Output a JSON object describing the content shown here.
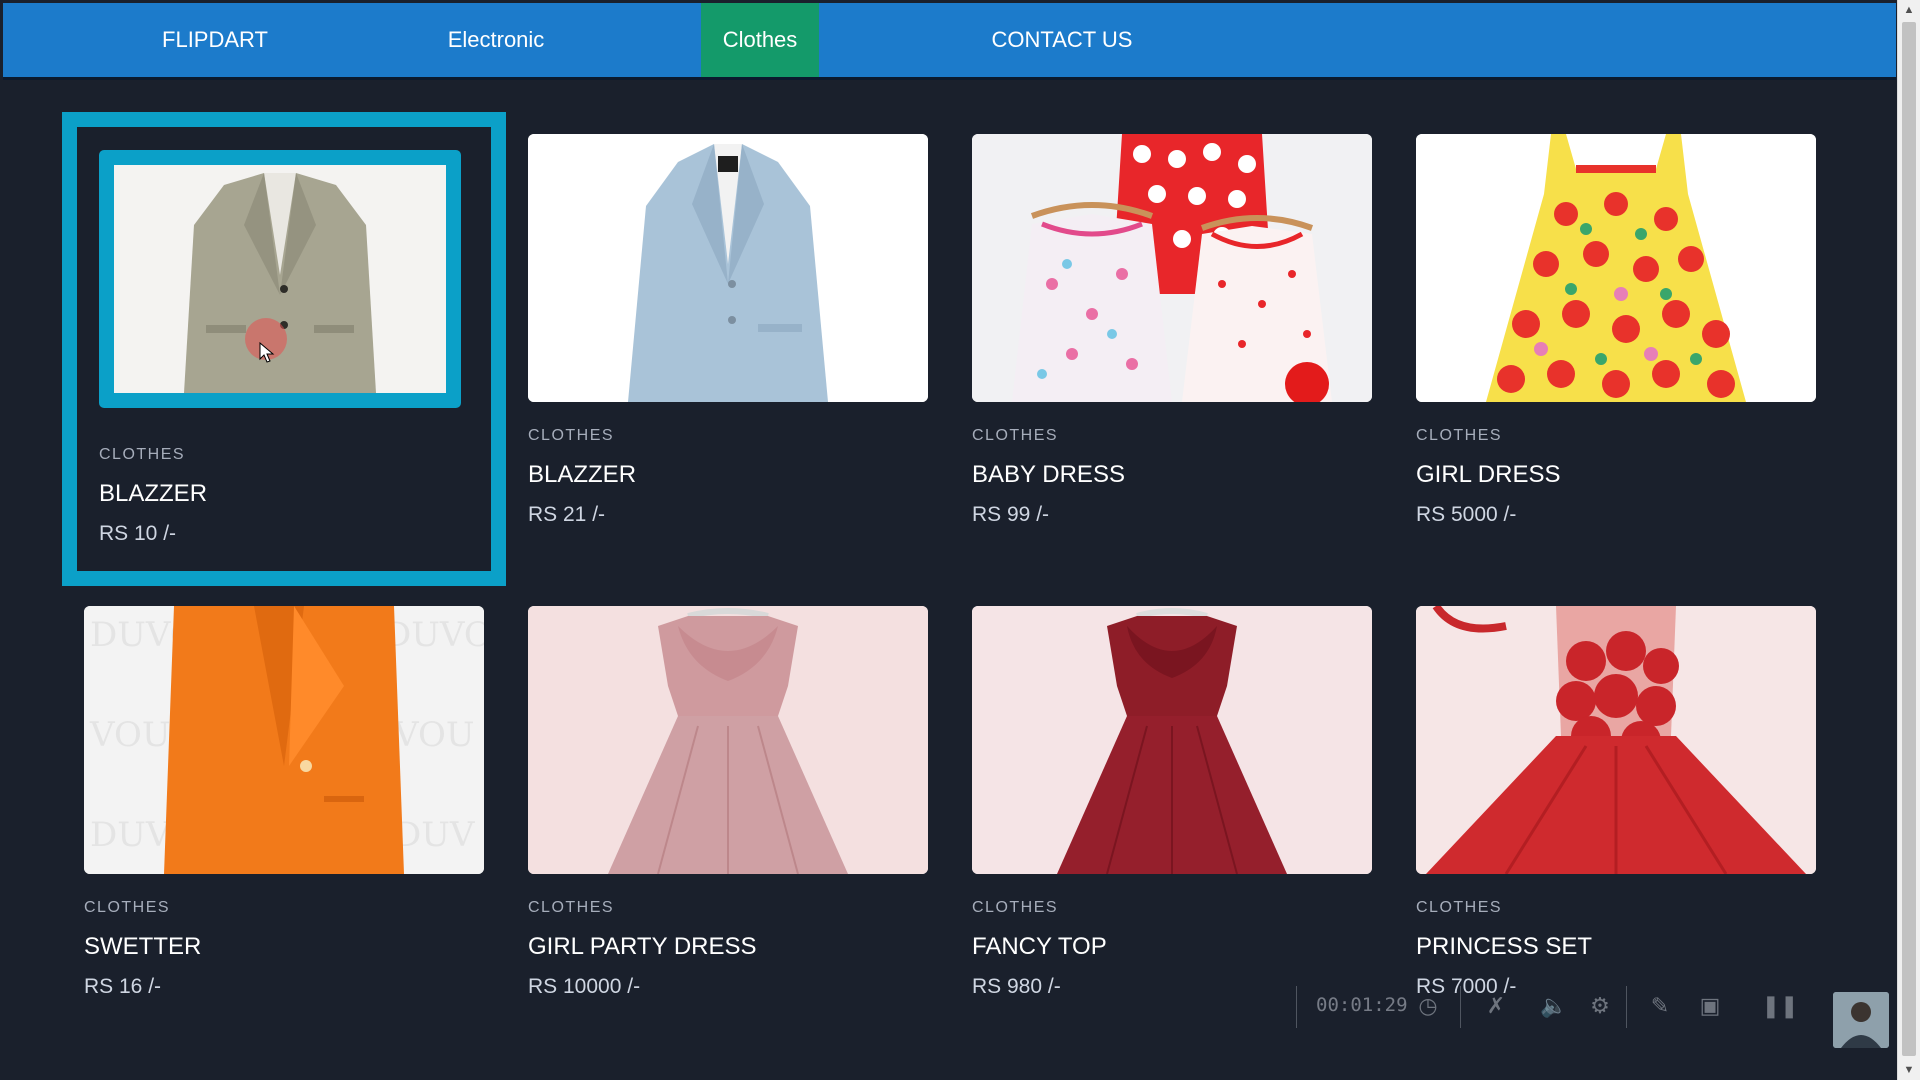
{
  "nav": {
    "brand": "FLIPDART",
    "items": [
      {
        "label": "Electronic"
      },
      {
        "label": "Clothes",
        "active": true
      },
      {
        "label": "CONTACT US"
      }
    ]
  },
  "products": [
    {
      "category": "CLOTHES",
      "title": "BLAZZER",
      "price": "RS 10 /-"
    },
    {
      "category": "CLOTHES",
      "title": "BLAZZER",
      "price": "RS 21 /-"
    },
    {
      "category": "CLOTHES",
      "title": "BABY DRESS",
      "price": "RS 99 /-"
    },
    {
      "category": "CLOTHES",
      "title": "GIRL DRESS",
      "price": "RS 5000 /-"
    },
    {
      "category": "CLOTHES",
      "title": "SWETTER",
      "price": "RS 16 /-"
    },
    {
      "category": "CLOTHES",
      "title": "GIRL PARTY DRESS",
      "price": "RS 10000 /-"
    },
    {
      "category": "CLOTHES",
      "title": "FANCY TOP",
      "price": "RS 980 /-"
    },
    {
      "category": "CLOTHES",
      "title": "PRINCESS SET",
      "price": "RS 7000 /-"
    }
  ],
  "recorder": {
    "time": "00:01:29",
    "icons": [
      "clock-icon",
      "mic-off-icon",
      "volume-icon",
      "gear-icon",
      "pen-icon",
      "camera-icon",
      "pause-icon"
    ]
  },
  "colors": {
    "nav_bg": "#1c7bcb",
    "nav_active": "#149a6a",
    "page_bg": "#1a202c",
    "hover_border": "#0ba0c8"
  }
}
